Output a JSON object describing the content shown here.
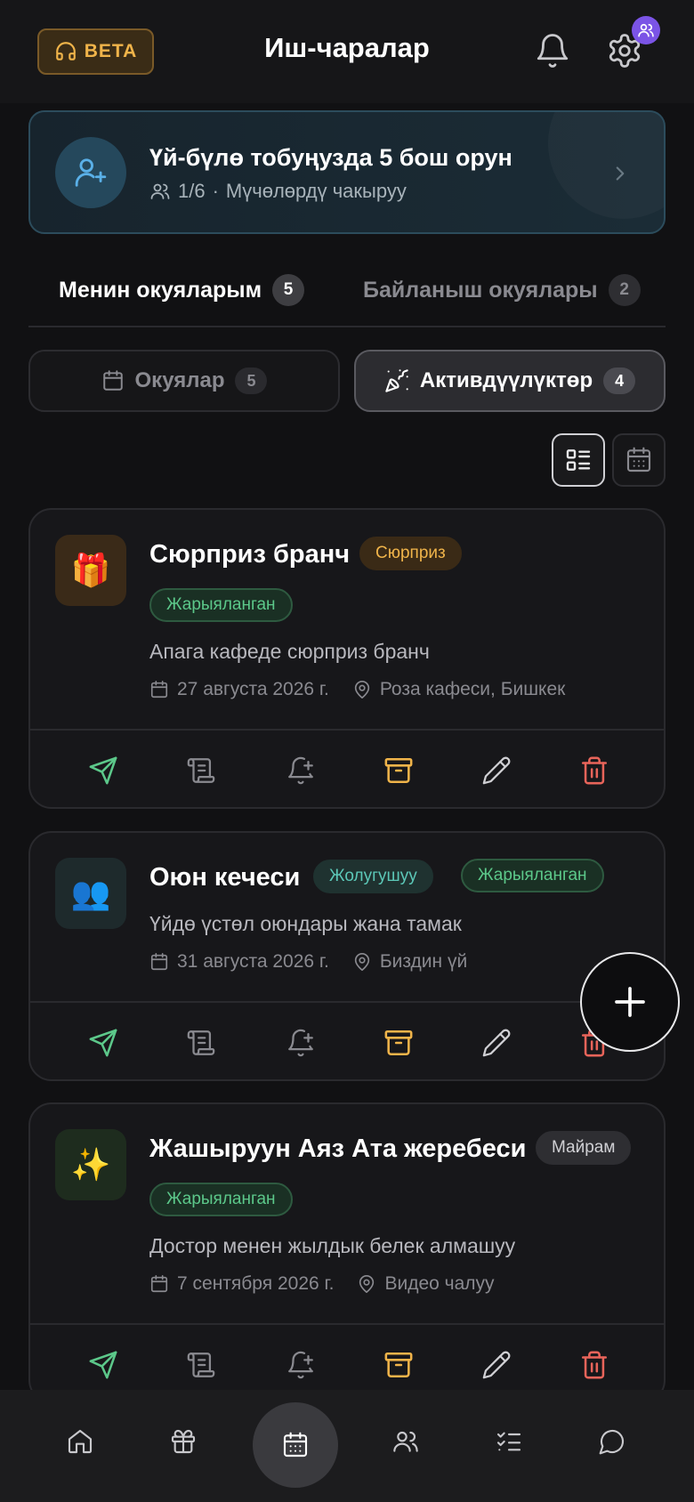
{
  "header": {
    "beta_label": "BETA",
    "title": "Иш-чаралар"
  },
  "banner": {
    "title": "Үй-бүлө тобуңузда 5 бош орун",
    "count": "1/6",
    "separator": "·",
    "cta": "Мүчөлөрдү чакыруу"
  },
  "tabs": [
    {
      "label": "Менин окуяларым",
      "count": "5"
    },
    {
      "label": "Байланыш окуялары",
      "count": "2"
    }
  ],
  "segments": [
    {
      "label": "Окуялар",
      "count": "5"
    },
    {
      "label": "Активдүүлүктөр",
      "count": "4"
    }
  ],
  "cards": [
    {
      "icon": "🎁",
      "title": "Сюрприз бранч",
      "badges": [
        "Сюрприз",
        "Жарыяланган"
      ],
      "description": "Апага кафеде сюрприз бранч",
      "date": "27 августа 2026 г.",
      "location": "Роза кафеси, Бишкек"
    },
    {
      "icon": "👥",
      "title": "Оюн кечеси",
      "badges": [
        "Жолугушуу",
        "Жарыяланган"
      ],
      "description": "Үйдө үстөл оюндары жана тамак",
      "date": "31 августа 2026 г.",
      "location": "Биздин үй"
    },
    {
      "icon": "✨",
      "title": "Жашыруун Аяз Ата жеребеси",
      "badges": [
        "Майрам",
        "Жарыяланган"
      ],
      "description": "Достор менен жылдык белек алмашуу",
      "date": "7 сентября 2026 г.",
      "location": "Видео чалуу"
    }
  ],
  "actions": [
    "send-icon",
    "scroll-icon",
    "bell-plus-icon",
    "archive-icon",
    "pencil-icon",
    "trash-icon"
  ],
  "bottom_nav": [
    "home-icon",
    "gift-icon",
    "calendar-icon",
    "users-icon",
    "checklist-icon",
    "chat-icon"
  ],
  "colors": {
    "accent_orange": "#f0b44a",
    "accent_green": "#5cc88a",
    "accent_red": "#e8645a",
    "accent_purple": "#7b54e6",
    "accent_blue": "#5ab0e8"
  }
}
